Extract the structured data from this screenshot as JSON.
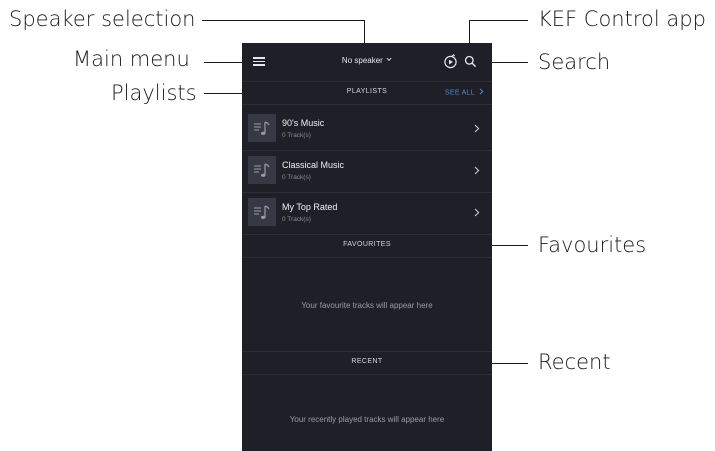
{
  "annotations": {
    "speaker_selection": "Speaker selection",
    "main_menu": "Main menu",
    "playlists": "Playlists",
    "kef_control_app": "KEF Control app",
    "search": "Search",
    "favourites": "Favourites",
    "recent": "Recent"
  },
  "app": {
    "topbar": {
      "speaker_label": "No speaker",
      "menu_icon": "hamburger-icon",
      "kef_icon": "kef-control-icon",
      "search_icon": "search-icon"
    },
    "playlists_section": {
      "title": "PLAYLISTS",
      "see_all": "SEE ALL",
      "items": [
        {
          "name": "90's Music",
          "count": "0 Track(s)"
        },
        {
          "name": "Classical Music",
          "count": "0 Track(s)"
        },
        {
          "name": "My Top Rated",
          "count": "0 Track(s)"
        }
      ]
    },
    "favourites_section": {
      "title": "FAVOURITES",
      "empty_message": "Your favourite tracks will appear here"
    },
    "recent_section": {
      "title": "RECENT",
      "empty_message": "Your recently played tracks will appear here"
    }
  },
  "colors": {
    "screen_background": "#1f2027",
    "divider": "#2c2d35",
    "accent_link": "#4f8ad6",
    "text_primary": "#f0f0f3",
    "text_secondary": "#8a8b95"
  }
}
